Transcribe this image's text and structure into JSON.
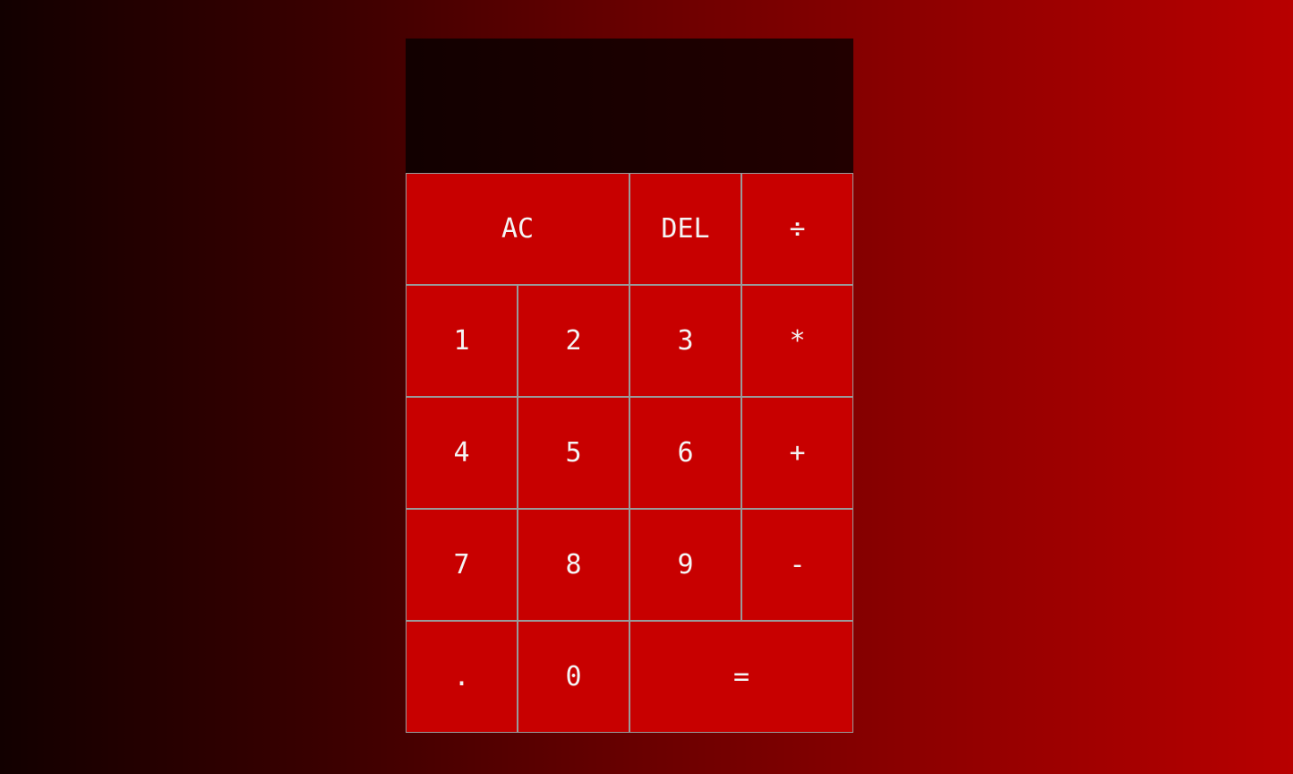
{
  "display": {
    "previous_operand": "",
    "current_operand": ""
  },
  "keys": {
    "all_clear": "AC",
    "delete": "DEL",
    "divide": "÷",
    "one": "1",
    "two": "2",
    "three": "3",
    "multiply": "*",
    "four": "4",
    "five": "5",
    "six": "6",
    "add": "+",
    "seven": "7",
    "eight": "8",
    "nine": "9",
    "subtract": "-",
    "decimal": ".",
    "zero": "0",
    "equals": "="
  },
  "colors": {
    "button_background": "#c80000",
    "button_border": "#9a9a9a",
    "display_background": "#1a0000",
    "page_gradient_start": "#120000",
    "page_gradient_end": "#b80000",
    "text": "#f4f4f4"
  }
}
